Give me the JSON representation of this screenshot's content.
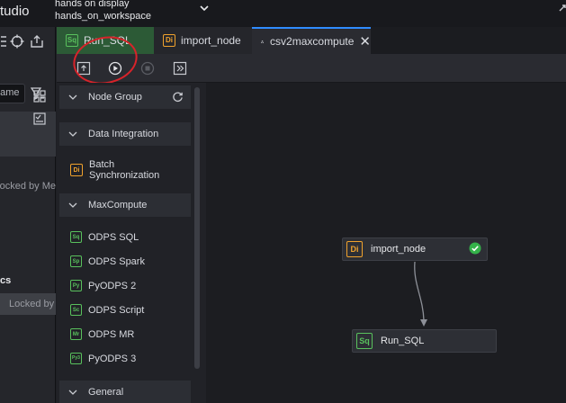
{
  "app": {
    "title_fragment": "tudio",
    "workspace_line1": "hands on display",
    "workspace_line2": "hands_on_workspace"
  },
  "left_panel": {
    "search_placeholder": "name",
    "locked_by_me": "Locked by Me",
    "section_label": "cs",
    "locked_by_row": "Locked by M"
  },
  "tabs": [
    {
      "label": "Run_SQL",
      "tag": "Sq"
    },
    {
      "label": "import_node",
      "tag": "Di"
    },
    {
      "label": "csv2maxcompute",
      "close": "✕"
    }
  ],
  "palette": {
    "groups": [
      {
        "label": "Node Group"
      },
      {
        "label": "Data Integration"
      },
      {
        "label": "MaxCompute"
      },
      {
        "label": "General"
      }
    ],
    "integration_items": [
      {
        "tag": "Di",
        "label_line1": "Batch",
        "label_line2": "Synchronization"
      }
    ],
    "maxcompute_items": [
      {
        "tag": "Sq",
        "label": "ODPS SQL"
      },
      {
        "tag": "Sp",
        "label": "ODPS Spark"
      },
      {
        "tag": "Py",
        "label": "PyODPS 2"
      },
      {
        "tag": "Sc",
        "label": "ODPS Script"
      },
      {
        "tag": "Mr",
        "label": "ODPS MR"
      },
      {
        "tag": "Py3",
        "label": "PyODPS 3"
      }
    ]
  },
  "canvas": {
    "nodes": [
      {
        "tag": "Di",
        "label": "import_node",
        "status": "success"
      },
      {
        "tag": "Sq",
        "label": "Run_SQL"
      }
    ]
  },
  "colors": {
    "accent": "#2f8cff",
    "sql_green": "#59c15d",
    "di_orange": "#f0a22d",
    "annotation_red": "#d8232a"
  }
}
